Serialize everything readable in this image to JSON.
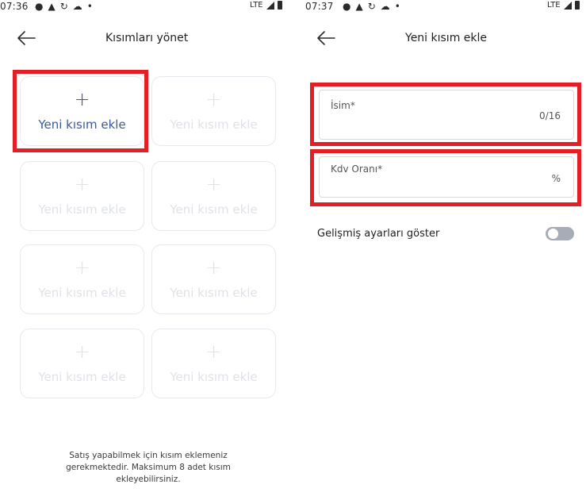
{
  "left_screen": {
    "status_bar": {
      "time": "07:36",
      "network": "LTE"
    },
    "title": "Kısımları yönet",
    "tiles": [
      {
        "label": "Yeni kısım ekle",
        "active": true
      },
      {
        "label": "Yeni kısım ekle",
        "active": false
      },
      {
        "label": "Yeni kısım ekle",
        "active": false
      },
      {
        "label": "Yeni kısım ekle",
        "active": false
      },
      {
        "label": "Yeni kısım ekle",
        "active": false
      },
      {
        "label": "Yeni kısım ekle",
        "active": false
      },
      {
        "label": "Yeni kısım ekle",
        "active": false
      },
      {
        "label": "Yeni kısım ekle",
        "active": false
      }
    ],
    "info_lines": [
      "Satış yapabilmek için kısım eklemeniz",
      "gerekmektedir. Maksimum 8 adet kısım",
      "ekleyebilirsiniz."
    ]
  },
  "right_screen": {
    "status_bar": {
      "time": "07:37",
      "network": "LTE"
    },
    "title": "Yeni kısım ekle",
    "name_field": {
      "label": "İsim*",
      "counter": "0/16",
      "value": ""
    },
    "vat_field": {
      "label": "Kdv Oranı*",
      "suffix": "%",
      "value": ""
    },
    "advanced_toggle": {
      "label": "Gelişmiş ayarları göster",
      "on": false
    }
  },
  "colors": {
    "highlight": "#e31e24",
    "accent": "#3b5aa3",
    "disabled_text": "#dfe2e8",
    "toggle_off": "#a7adb6"
  }
}
